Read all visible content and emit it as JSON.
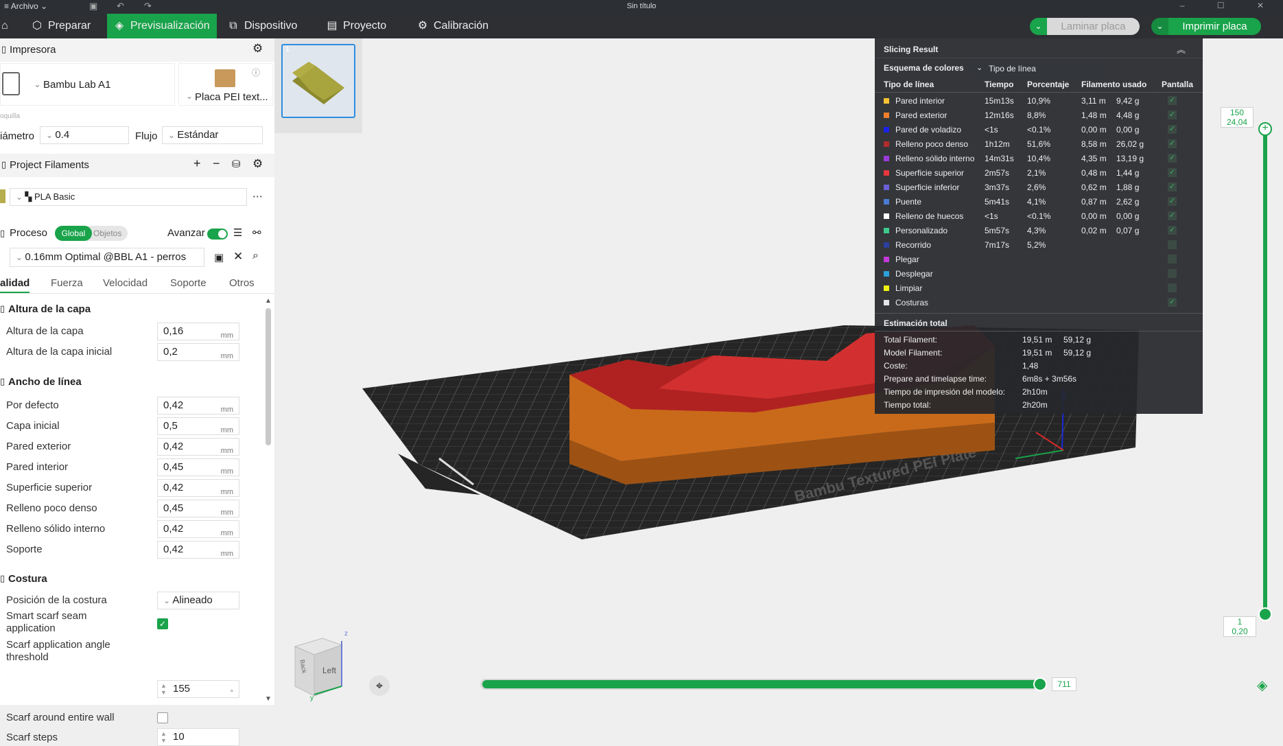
{
  "titlebar": {
    "menu": "Archivo",
    "title": "Sin título"
  },
  "tabs": [
    {
      "label": "Preparar",
      "icon": "cube-icon"
    },
    {
      "label": "Previsualización",
      "icon": "layers-icon"
    },
    {
      "label": "Dispositivo",
      "icon": "device-icon"
    },
    {
      "label": "Proyecto",
      "icon": "project-icon"
    },
    {
      "label": "Calibración",
      "icon": "calibration-icon"
    }
  ],
  "actions": {
    "slice": "Laminar placa",
    "print": "Imprimir placa"
  },
  "printer": {
    "section": "Impresora",
    "name": "Bambu Lab A1",
    "plate": "Placa PEI text...",
    "nozzle_caption": "oquilla",
    "diameter_label": "iámetro",
    "diameter_value": "0.4",
    "flow_label": "Flujo",
    "flow_value": "Estándar"
  },
  "filaments": {
    "section": "Project Filaments",
    "item": "PLA Basic",
    "color": "#b6ad4c"
  },
  "process": {
    "section": "Proceso",
    "global": "Global",
    "objects": "Objetos",
    "advance": "Avanzar",
    "profile": "0.16mm Optimal @BBL A1 - perros",
    "tabs": [
      "alidad",
      "Fuerza",
      "Velocidad",
      "Soporte",
      "Otros"
    ]
  },
  "settings": {
    "layer_group": "Altura de la capa",
    "layer_height": {
      "label": "Altura de la capa",
      "value": "0,16",
      "unit": "mm"
    },
    "initial_layer": {
      "label": "Altura de la capa inicial",
      "value": "0,2",
      "unit": "mm"
    },
    "width_group": "Ancho de línea",
    "widths": [
      {
        "label": "Por defecto",
        "value": "0,42",
        "unit": "mm"
      },
      {
        "label": "Capa inicial",
        "value": "0,5",
        "unit": "mm"
      },
      {
        "label": "Pared exterior",
        "value": "0,42",
        "unit": "mm"
      },
      {
        "label": "Pared interior",
        "value": "0,45",
        "unit": "mm"
      },
      {
        "label": "Superficie superior",
        "value": "0,42",
        "unit": "mm"
      },
      {
        "label": "Relleno poco denso",
        "value": "0,45",
        "unit": "mm"
      },
      {
        "label": "Relleno sólido interno",
        "value": "0,42",
        "unit": "mm"
      },
      {
        "label": "Soporte",
        "value": "0,42",
        "unit": "mm"
      }
    ],
    "seam_group": "Costura",
    "seam_position": {
      "label": "Posición de la costura",
      "value": "Alineado"
    },
    "smart_scarf": {
      "label1": "Smart scarf seam",
      "label2": "application"
    },
    "scarf_angle": {
      "label1": "Scarf application angle",
      "label2": "threshold",
      "value": "155",
      "unit": "°"
    },
    "scarf_around": {
      "label": "Scarf around entire wall"
    },
    "scarf_steps": {
      "label": "Scarf steps",
      "value": "10"
    }
  },
  "preview": {
    "plate_number": "1",
    "plate_text": "Bambu Textured PEI Plate",
    "cube_face": "Left",
    "cube_side": "Back",
    "axis_z": "z",
    "axis_y": "y"
  },
  "slicing": {
    "title": "Slicing Result",
    "scheme_label": "Esquema de colores",
    "scheme_value": "Tipo de línea",
    "columns": [
      "Tipo de línea",
      "Tiempo",
      "Porcentaje",
      "Filamento usado",
      "Pantalla"
    ],
    "rows": [
      {
        "name": "Pared interior",
        "color": "#f5c331",
        "time": "15m13s",
        "pct": "10,9%",
        "len": "3,11 m",
        "g": "9,42 g",
        "show": true
      },
      {
        "name": "Pared exterior",
        "color": "#ee7f2d",
        "time": "12m16s",
        "pct": "8,8%",
        "len": "1,48 m",
        "g": "4,48 g",
        "show": true
      },
      {
        "name": "Pared de voladizo",
        "color": "#1a22e8",
        "time": "<1s",
        "pct": "<0.1%",
        "len": "0,00 m",
        "g": "0,00 g",
        "show": true
      },
      {
        "name": "Relleno poco denso",
        "color": "#b22c2c",
        "time": "1h12m",
        "pct": "51,6%",
        "len": "8,58 m",
        "g": "26,02 g",
        "show": true
      },
      {
        "name": "Relleno sólido interno",
        "color": "#9a3ad9",
        "time": "14m31s",
        "pct": "10,4%",
        "len": "4,35 m",
        "g": "13,19 g",
        "show": true
      },
      {
        "name": "Superficie superior",
        "color": "#e8373a",
        "time": "2m57s",
        "pct": "2,1%",
        "len": "0,48 m",
        "g": "1,44 g",
        "show": true
      },
      {
        "name": "Superficie inferior",
        "color": "#6a5fd6",
        "time": "3m37s",
        "pct": "2,6%",
        "len": "0,62 m",
        "g": "1,88 g",
        "show": true
      },
      {
        "name": "Puente",
        "color": "#4a7bd3",
        "time": "5m41s",
        "pct": "4,1%",
        "len": "0,87 m",
        "g": "2,62 g",
        "show": true
      },
      {
        "name": "Relleno de huecos",
        "color": "#ffffff",
        "time": "<1s",
        "pct": "<0.1%",
        "len": "0,00 m",
        "g": "0,00 g",
        "show": true
      },
      {
        "name": "Personalizado",
        "color": "#3ec98b",
        "time": "5m57s",
        "pct": "4,3%",
        "len": "0,02 m",
        "g": "0,07 g",
        "show": true
      },
      {
        "name": "Recorrido",
        "color": "#2b3fa0",
        "time": "7m17s",
        "pct": "5,2%",
        "len": "",
        "g": "",
        "show": false
      },
      {
        "name": "Plegar",
        "color": "#c23ad8",
        "time": "",
        "pct": "",
        "len": "",
        "g": "",
        "show": false
      },
      {
        "name": "Desplegar",
        "color": "#2ba0d8",
        "time": "",
        "pct": "",
        "len": "",
        "g": "",
        "show": false
      },
      {
        "name": "Limpiar",
        "color": "#f2f20f",
        "time": "",
        "pct": "",
        "len": "",
        "g": "",
        "show": false
      },
      {
        "name": "Costuras",
        "color": "#e6e6e6",
        "time": "",
        "pct": "",
        "len": "",
        "g": "",
        "show": true
      }
    ],
    "estimate_title": "Estimación total",
    "estimates": [
      {
        "label": "Total Filament:",
        "v1": "19,51 m",
        "v2": "59,12 g"
      },
      {
        "label": "Model Filament:",
        "v1": "19,51 m",
        "v2": "59,12 g"
      },
      {
        "label": "Coste:",
        "v1": "1,48",
        "v2": ""
      },
      {
        "label": "Prepare and timelapse time:",
        "v1": "6m8s + 3m56s",
        "v2": ""
      },
      {
        "label": "Tiempo de impresión del modelo:",
        "v1": "2h10m",
        "v2": ""
      },
      {
        "label": "Tiempo total:",
        "v1": "2h20m",
        "v2": ""
      }
    ]
  },
  "layers": {
    "top": "150",
    "top_h": "24,04",
    "bottom": "1",
    "bottom_h": "0,20",
    "moves": "711"
  }
}
